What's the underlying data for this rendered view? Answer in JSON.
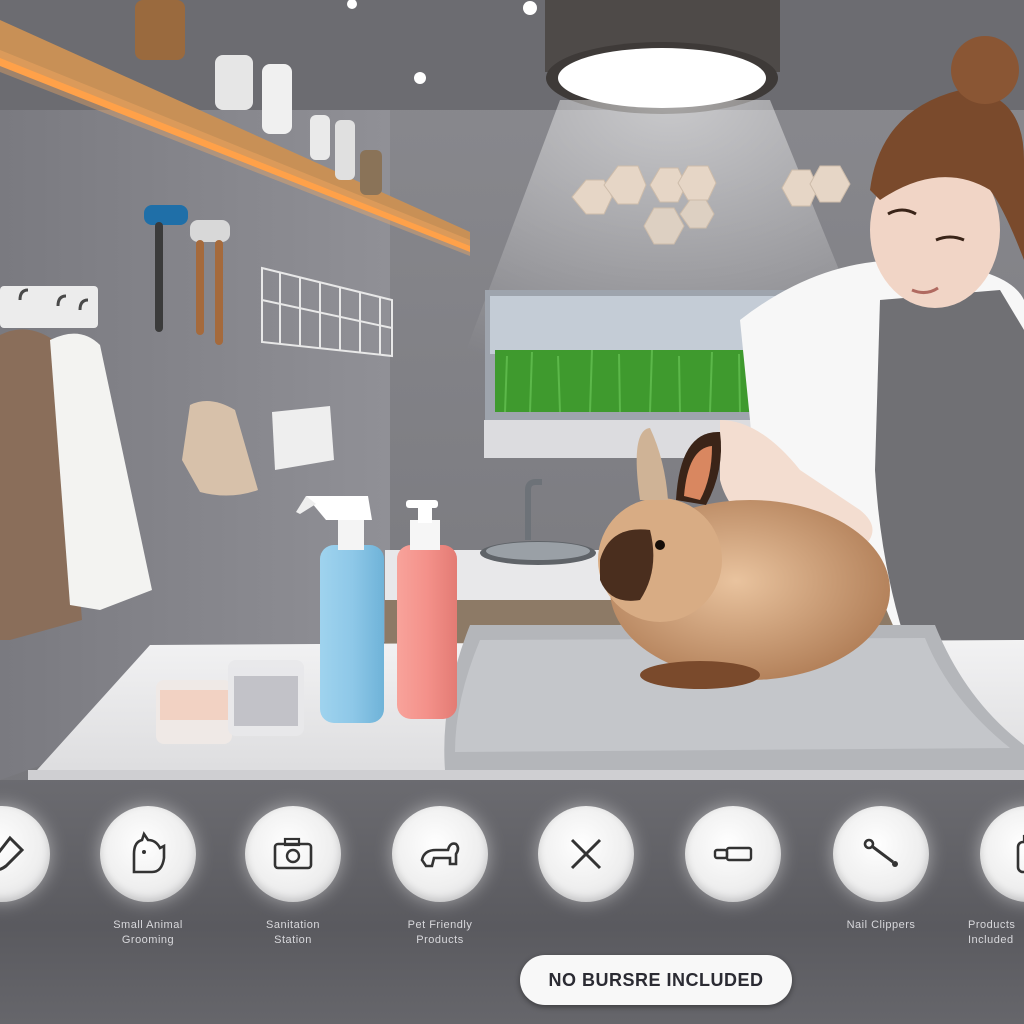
{
  "banner": {
    "no_brushes_label": "NO BURSRE INCLUDED"
  },
  "icons": [
    {
      "name": "brush-icon",
      "label_line1": "",
      "label_line2": ""
    },
    {
      "name": "small-animal-icon",
      "label_line1": "Small Animal",
      "label_line2": "Grooming"
    },
    {
      "name": "camera-icon",
      "label_line1": "Sanitation",
      "label_line2": "Station"
    },
    {
      "name": "pet-icon",
      "label_line1": "Pet Friendly",
      "label_line2": "Products"
    },
    {
      "name": "scissors-icon",
      "label_line1": "",
      "label_line2": ""
    },
    {
      "name": "comb-icon",
      "label_line1": "",
      "label_line2": ""
    },
    {
      "name": "nail-clipper-icon",
      "label_line1": "Nail Clippers",
      "label_line2": ""
    },
    {
      "name": "bottle-icon",
      "label_line1": "Products",
      "label_line2": "Included"
    }
  ],
  "colors": {
    "bar_background": "#5d5d62",
    "spray_bottle": "#8ec8e8",
    "pump_bottle": "#f4918a",
    "shelf_light": "#ff9a3c",
    "grass": "#3f9a2e"
  }
}
